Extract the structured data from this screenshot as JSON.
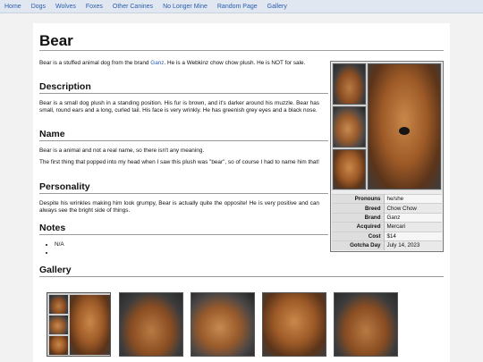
{
  "nav": {
    "items": [
      "Home",
      "Dogs",
      "Wolves",
      "Foxes",
      "Other Canines",
      "No Longer Mine",
      "Random Page",
      "Gallery"
    ]
  },
  "page": {
    "title": "Bear",
    "intro_before": "Bear is a stuffed animal dog from the brand ",
    "intro_link": "Ganz",
    "intro_after": ". He is a Webkinz chow chow plush. He is NOT for sale."
  },
  "sections": {
    "description": {
      "heading": "Description",
      "text": "Bear is a small dog plush in a standing position. His fur is brown, and it's darker around his muzzle. Bear has small, round ears and a long, curled tail. His face is very wrinkly. He has greenish grey eyes and a black nose."
    },
    "name": {
      "heading": "Name",
      "text1": "Bear is a animal and not a real name, so there isn't any meaning.",
      "text2": "The first thing that popped into my head when I saw this plush was \"bear\", so of course I had to name him that!"
    },
    "personality": {
      "heading": "Personality",
      "text": "Despite his wrinkles making him look grumpy, Bear is actually quite the opposite! He is very positive and can always see the bright side of things."
    },
    "notes": {
      "heading": "Notes",
      "items": [
        "N/A",
        ""
      ]
    },
    "gallery": {
      "heading": "Gallery"
    }
  },
  "infobox": {
    "rows": [
      {
        "key": "Pronouns",
        "value": "he/she"
      },
      {
        "key": "Breed",
        "value": "Chow Chow"
      },
      {
        "key": "Brand",
        "value": "Ganz"
      },
      {
        "key": "Acquired",
        "value": "Mercari"
      },
      {
        "key": "Cost",
        "value": "$14"
      },
      {
        "key": "Gotcha Day",
        "value": "July 14, 2023"
      }
    ]
  },
  "colors": {
    "link": "#2a5db0",
    "nav_bg": "#e1e7f0",
    "page_bg": "#ffffff",
    "body_bg": "#f2f2f2"
  }
}
